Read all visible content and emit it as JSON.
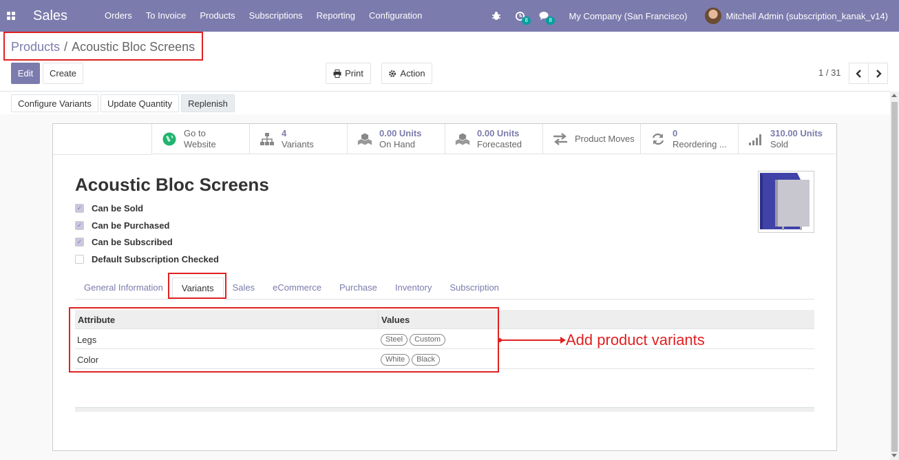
{
  "navbar": {
    "brand": "Sales",
    "menu": [
      "Orders",
      "To Invoice",
      "Products",
      "Subscriptions",
      "Reporting",
      "Configuration"
    ],
    "activity_count": "8",
    "message_count": "8",
    "company": "My Company (San Francisco)",
    "user": "Mitchell Admin (subscription_kanak_v14)"
  },
  "breadcrumb": {
    "parent": "Products",
    "separator": "/",
    "current": "Acoustic Bloc Screens"
  },
  "buttons": {
    "edit": "Edit",
    "create": "Create",
    "print": "Print",
    "action": "Action"
  },
  "pager": "1 / 31",
  "header_buttons": [
    "Configure Variants",
    "Update Quantity",
    "Replenish"
  ],
  "smart_buttons": [
    {
      "icon": "globe-icon",
      "value": "",
      "label1": "Go to",
      "label2": "Website"
    },
    {
      "icon": "sitemap-icon",
      "value": "4",
      "label2": "Variants"
    },
    {
      "icon": "cubes-icon",
      "value": "0.00 Units",
      "label2": "On Hand"
    },
    {
      "icon": "cubes-icon",
      "value": "0.00 Units",
      "label2": "Forecasted"
    },
    {
      "icon": "exchange-icon",
      "value": "",
      "label1": "Product Moves"
    },
    {
      "icon": "refresh-icon",
      "value": "0",
      "label2": "Reordering ..."
    },
    {
      "icon": "signal-icon",
      "value": "310.00 Units",
      "label2": "Sold"
    }
  ],
  "product": {
    "name": "Acoustic Bloc Screens",
    "checkboxes": [
      {
        "label": "Can be Sold",
        "checked": true
      },
      {
        "label": "Can be Purchased",
        "checked": true
      },
      {
        "label": "Can be Subscribed",
        "checked": true
      },
      {
        "label": "Default Subscription Checked",
        "checked": false
      }
    ]
  },
  "tabs": [
    "General Information",
    "Variants",
    "Sales",
    "eCommerce",
    "Purchase",
    "Inventory",
    "Subscription"
  ],
  "active_tab": "Variants",
  "variants_table": {
    "headers": [
      "Attribute",
      "Values"
    ],
    "rows": [
      {
        "attribute": "Legs",
        "values": [
          "Steel",
          "Custom"
        ]
      },
      {
        "attribute": "Color",
        "values": [
          "White",
          "Black"
        ]
      }
    ]
  },
  "annotation": "Add product variants",
  "colors": {
    "brand": "#7c7bad",
    "annotation": "#e02020",
    "teal_badge": "#00a09d"
  }
}
